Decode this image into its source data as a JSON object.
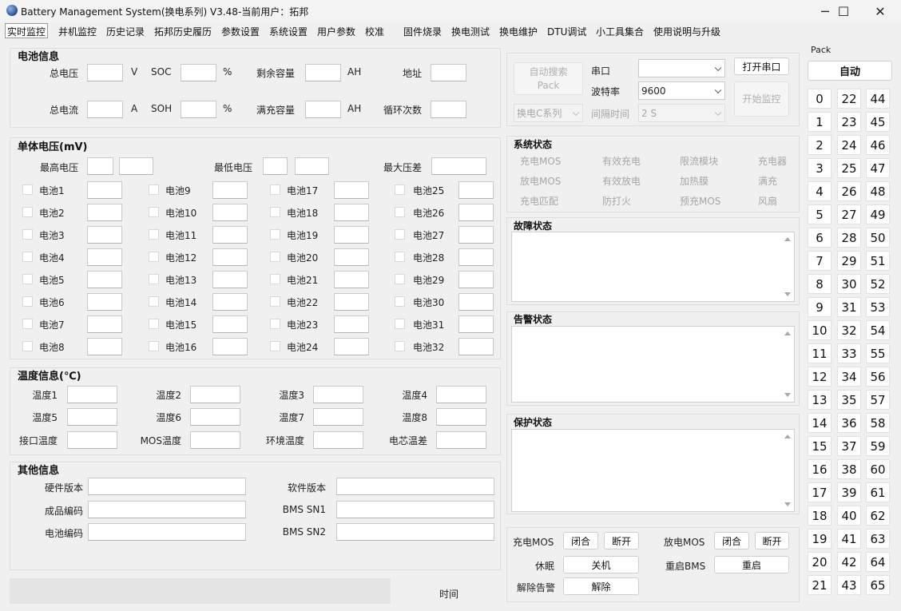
{
  "window": {
    "title": "Battery Management System(换电系列) V3.48-当前用户：拓邦",
    "minimize": "─",
    "maximize": "☐",
    "close": "✕"
  },
  "tabs": [
    "实时监控",
    "并机监控",
    "历史记录",
    "拓邦历史履历",
    "参数设置",
    "系统设置",
    "用户参数",
    "校准",
    "固件烧录",
    "换电测试",
    "换电维护",
    "DTU调试",
    "小工具集合",
    "使用说明与升级"
  ],
  "battery_info": {
    "title": "电池信息",
    "total_voltage": "总电压",
    "v_unit": "V",
    "soc": "SOC",
    "pct1": "%",
    "remaining_capacity": "剩余容量",
    "ah1": "AH",
    "address": "地址",
    "total_current": "总电流",
    "a_unit": "A",
    "soh": "SOH",
    "pct2": "%",
    "full_capacity": "满充容量",
    "ah2": "AH",
    "cycle_count": "循环次数"
  },
  "cell_voltage": {
    "title": "单体电压(mV)",
    "max_voltage": "最高电压",
    "min_voltage": "最低电压",
    "max_diff": "最大压差",
    "cells": [
      "电池1",
      "电池2",
      "电池3",
      "电池4",
      "电池5",
      "电池6",
      "电池7",
      "电池8",
      "电池9",
      "电池10",
      "电池11",
      "电池12",
      "电池13",
      "电池14",
      "电池15",
      "电池16",
      "电池17",
      "电池18",
      "电池19",
      "电池20",
      "电池21",
      "电池22",
      "电池23",
      "电池24",
      "电池25",
      "电池26",
      "电池27",
      "电池28",
      "电池29",
      "电池30",
      "电池31",
      "电池32"
    ]
  },
  "temperature": {
    "title": "温度信息(℃)",
    "labels": [
      "温度1",
      "温度2",
      "温度3",
      "温度4",
      "温度5",
      "温度6",
      "温度7",
      "温度8",
      "接口温度",
      "MOS温度",
      "环境温度",
      "电芯温差"
    ]
  },
  "other_info": {
    "title": "其他信息",
    "hw_version": "硬件版本",
    "sw_version": "软件版本",
    "product_code": "成品编码",
    "bms_sn1": "BMS SN1",
    "battery_code": "电池编码",
    "bms_sn2": "BMS SN2"
  },
  "connection": {
    "auto_search_line1": "自动搜索",
    "auto_search_line2": "Pack",
    "serial_port_label": "串口",
    "serial_port_value": "",
    "baud_label": "波特率",
    "baud_value": "9600",
    "open_port": "打开串口",
    "start_monitor": "开始监控",
    "series_value": "换电C系列",
    "interval_label": "间隔时间",
    "interval_value": "2 S"
  },
  "system_status": {
    "title": "系统状态",
    "items": [
      "充电MOS",
      "有效充电",
      "限流模块",
      "充电器",
      "放电MOS",
      "有效放电",
      "加热膜",
      "满充",
      "充电匹配",
      "防打火",
      "预充MOS",
      "风扇"
    ]
  },
  "fault_status": {
    "title": "故障状态"
  },
  "alarm_status": {
    "title": "告警状态"
  },
  "protect_status": {
    "title": "保护状态"
  },
  "controls": {
    "charge_mos": "充电MOS",
    "discharge_mos": "放电MOS",
    "close": "闭合",
    "open": "断开",
    "sleep": "休眠",
    "shutdown": "关机",
    "restart_bms": "重启BMS",
    "restart": "重启",
    "clear_alarm": "解除告警",
    "release": "解除"
  },
  "pack": {
    "title": "Pack",
    "auto": "自动",
    "ids": [
      "0",
      "1",
      "2",
      "3",
      "4",
      "5",
      "6",
      "7",
      "8",
      "9",
      "10",
      "11",
      "12",
      "13",
      "14",
      "15",
      "16",
      "17",
      "18",
      "19",
      "20",
      "21",
      "22",
      "23",
      "24",
      "25",
      "26",
      "27",
      "28",
      "29",
      "30",
      "31",
      "32",
      "33",
      "34",
      "35",
      "36",
      "37",
      "38",
      "39",
      "40",
      "41",
      "42",
      "43",
      "44",
      "45",
      "46",
      "47",
      "48",
      "49",
      "50",
      "51",
      "52",
      "53",
      "54",
      "55",
      "56",
      "57",
      "58",
      "59",
      "60",
      "61",
      "62",
      "63",
      "64",
      "65"
    ]
  },
  "statusbar": {
    "time_label": "时间"
  },
  "icons": {
    "minimize": "minimize-icon",
    "maximize": "maximize-icon",
    "close": "close-icon",
    "app": "battery-app-icon",
    "dropdown": "chevron-down-icon"
  }
}
